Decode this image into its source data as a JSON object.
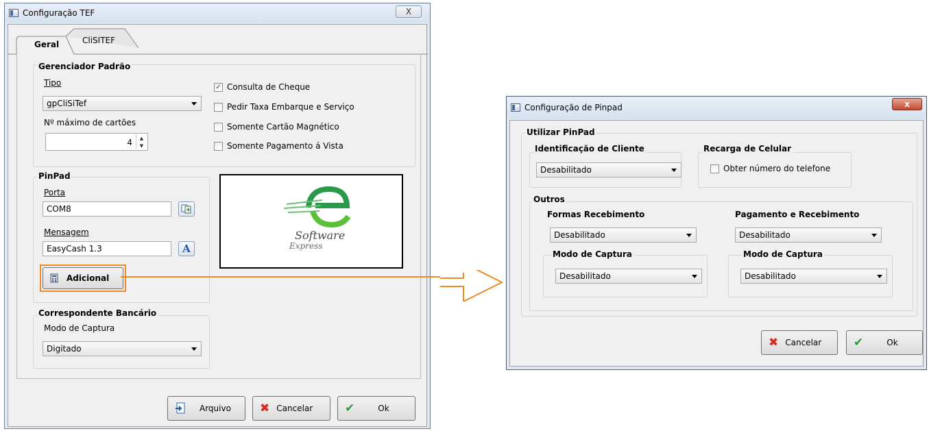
{
  "tef": {
    "title": "Configuração TEF",
    "close": "X",
    "tabs": [
      {
        "label": "Geral"
      },
      {
        "label": "CliSITEF"
      }
    ],
    "gerenciador": {
      "title": "Gerenciador Padrão",
      "tipo_label": "Tipo",
      "tipo_value": "gpCliSiTef",
      "max_label": "Nº máximo de cartões",
      "max_value": "4",
      "checkboxes": [
        {
          "label": "Consulta de Cheque",
          "checked": true
        },
        {
          "label": "Pedir Taxa Embarque e Serviço",
          "checked": false
        },
        {
          "label": "Somente Cartão Magnético",
          "checked": false
        },
        {
          "label": "Somente Pagamento á Vista",
          "checked": false
        }
      ]
    },
    "pinpad": {
      "title": "PinPad",
      "porta_label": "Porta",
      "porta_value": "COM8",
      "mensagem_label": "Mensagem",
      "mensagem_value": "EasyCash 1.3",
      "adicional_label": "Adicional"
    },
    "logo": {
      "line1": "Software",
      "line2": "Express"
    },
    "correspondente": {
      "title": "Correspondente Bancário",
      "modo_label": "Modo de Captura",
      "modo_value": "Digitado"
    },
    "buttons": {
      "arquivo": "Arquivo",
      "cancelar": "Cancelar",
      "ok": "Ok"
    }
  },
  "pinpad_dialog": {
    "title": "Configuração de Pinpad",
    "close": "x",
    "utilizar_label": "Utilizar PinPad",
    "identificacao": {
      "title": "Identificação de Cliente",
      "value": "Desabilitado"
    },
    "recarga": {
      "title": "Recarga de Celular",
      "checkbox": "Obter número do telefone",
      "checked": false
    },
    "outros_label": "Outros",
    "formas": {
      "title": "Formas Recebimento",
      "value": "Desabilitado",
      "modo_title": "Modo de Captura",
      "modo_value": "Desabilitado"
    },
    "pagamento": {
      "title": "Pagamento e Recebimento",
      "value": "Desabilitado",
      "modo_title": "Modo de Captura",
      "modo_value": "Desabilitado"
    },
    "buttons": {
      "cancelar": "Cancelar",
      "ok": "Ok"
    }
  },
  "colors": {
    "highlight": "#f08a24",
    "cancel_icon": "#d62b1f",
    "ok_icon": "#2e9a2e"
  }
}
